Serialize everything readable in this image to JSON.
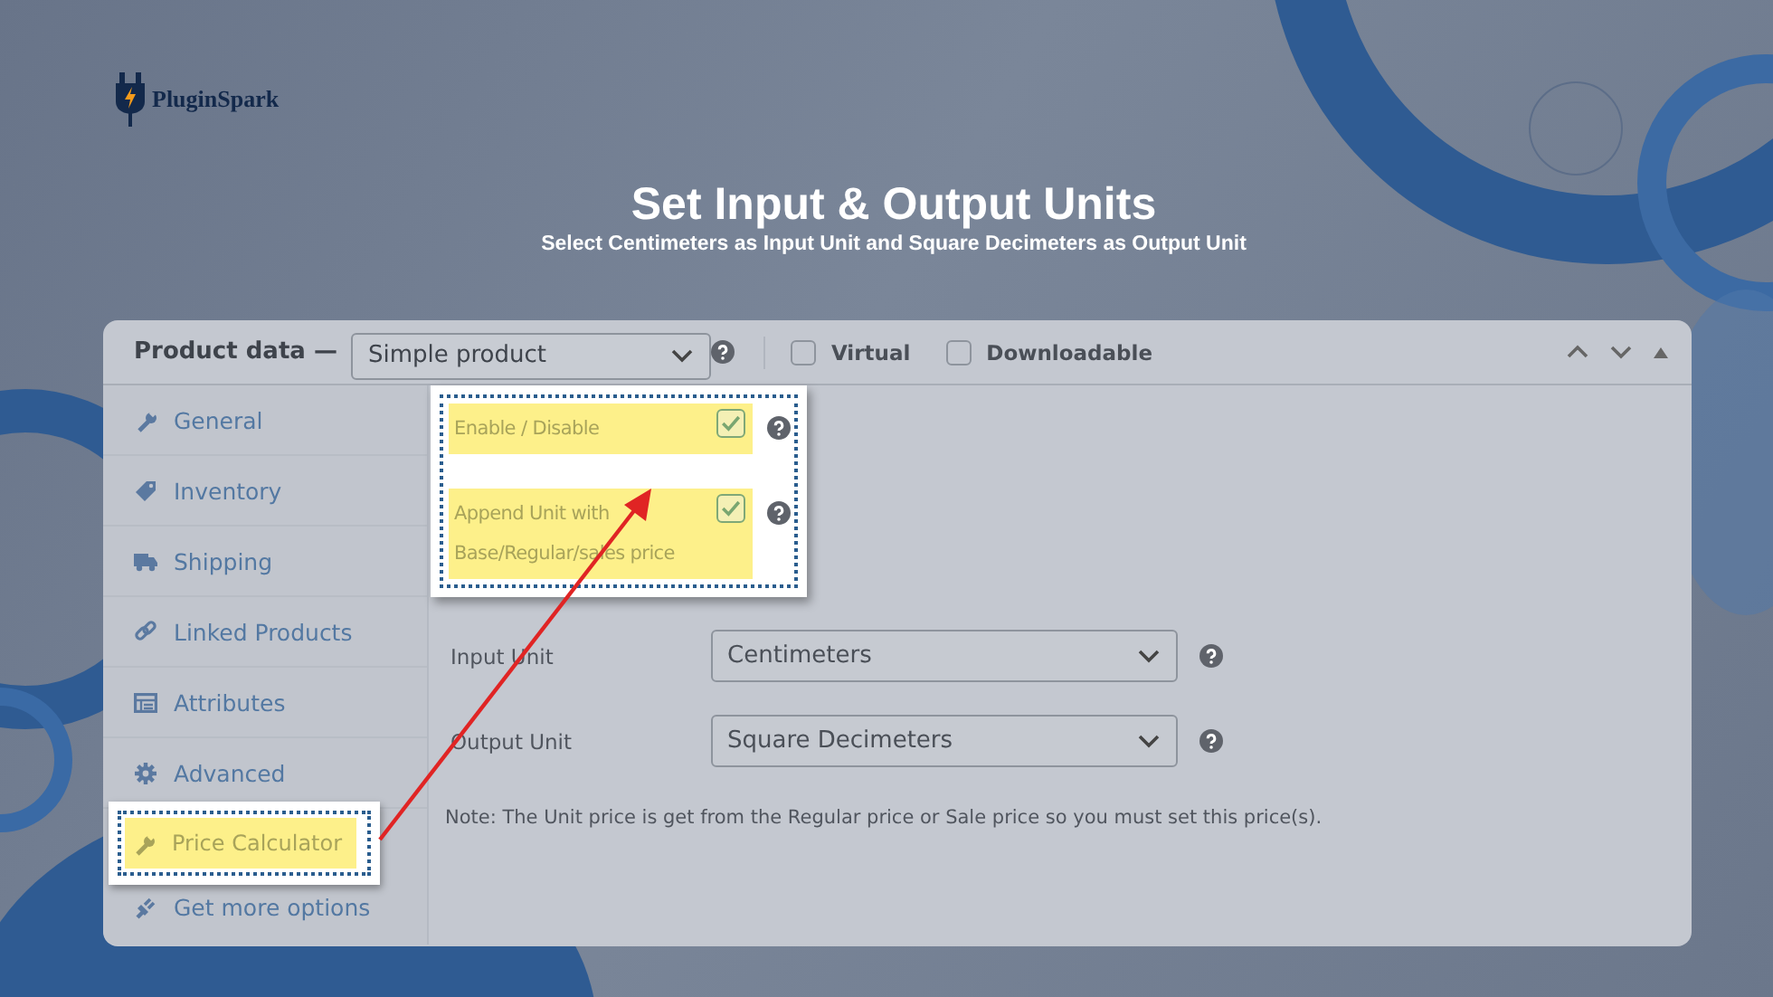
{
  "brand": {
    "name": "PluginSpark"
  },
  "heading": {
    "title": "Set Input & Output Units",
    "subtitle": "Select Centimeters as Input Unit and Square Decimeters as Output Unit"
  },
  "panel": {
    "title": "Product data —",
    "product_type": "Simple product",
    "options": [
      {
        "label": "Virtual",
        "checked": false
      },
      {
        "label": "Downloadable",
        "checked": false
      }
    ],
    "tabs": [
      {
        "label": "General",
        "selected": false
      },
      {
        "label": "Inventory",
        "selected": false
      },
      {
        "label": "Shipping",
        "selected": false
      },
      {
        "label": "Linked Products",
        "selected": false
      },
      {
        "label": "Attributes",
        "selected": false
      },
      {
        "label": "Advanced",
        "selected": false
      },
      {
        "label": "Price Calculator",
        "selected": true
      },
      {
        "label": "Get more options",
        "selected": false
      }
    ],
    "settings": [
      {
        "label": "Enable / Disable",
        "checked": true
      },
      {
        "label": "Append Unit with Base/Regular/sales price",
        "checked": true
      }
    ],
    "fields": [
      {
        "label": "Input Unit",
        "value": "Centimeters"
      },
      {
        "label": "Output Unit",
        "value": "Square Decimeters"
      }
    ],
    "note": "Note: The Unit price is get from the Regular price or Sale price so you must set this price(s)."
  }
}
